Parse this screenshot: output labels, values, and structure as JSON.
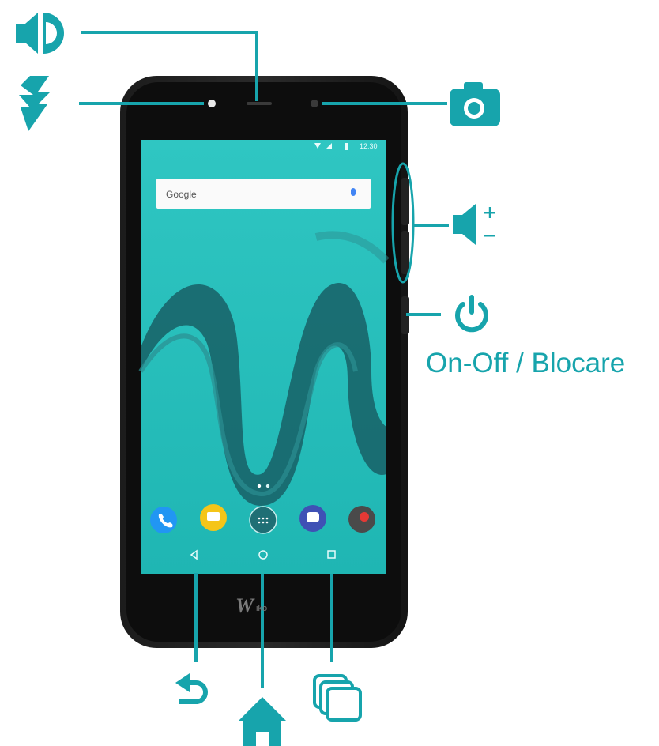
{
  "accent_color": "#17a4ac",
  "labels": {
    "power_label": "On-Off / Blocare"
  },
  "screen": {
    "search_widget_text": "Google",
    "status_time": "12:30",
    "brand_logo": "W",
    "brand_logo_rest": "iko"
  },
  "callouts": [
    {
      "name": "earpiece-speaker",
      "icon": "speaker-icon"
    },
    {
      "name": "front-flash",
      "icon": "flash-icon"
    },
    {
      "name": "front-camera",
      "icon": "camera-icon"
    },
    {
      "name": "volume-keys",
      "icon": "volume-plus-minus-icon"
    },
    {
      "name": "power-key",
      "icon": "power-icon"
    },
    {
      "name": "back-key",
      "icon": "back-arrow-icon"
    },
    {
      "name": "home-key",
      "icon": "home-icon"
    },
    {
      "name": "recent-apps-key",
      "icon": "recent-apps-icon"
    }
  ],
  "dock_apps": [
    "phone-app-icon",
    "messaging-app-icon",
    "app-drawer-icon",
    "message-app-icon",
    "camera-app-icon"
  ]
}
